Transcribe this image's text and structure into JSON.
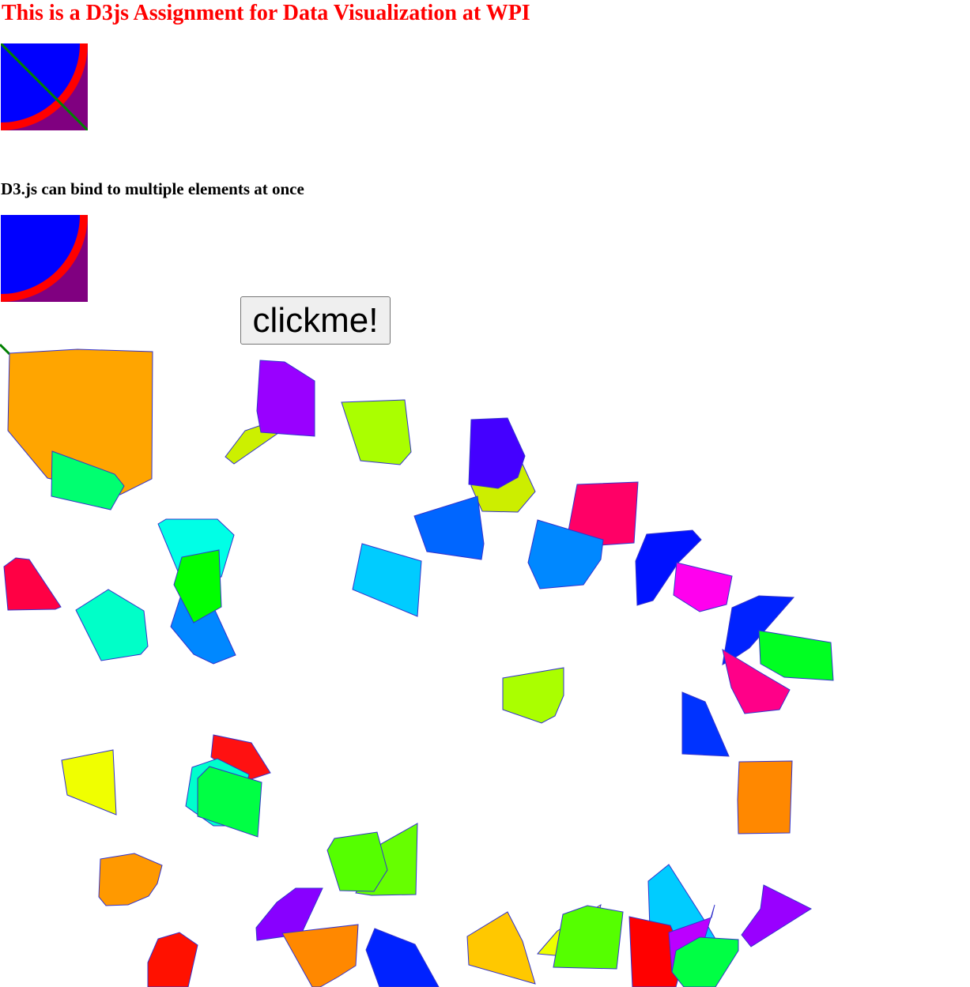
{
  "page": {
    "title": "This is a D3js Assignment for Data Visualization at WPI",
    "subtitle": "D3.js can bind to multiple elements at once",
    "button_label": "clickme!"
  },
  "colors": {
    "title": "#ff0000",
    "square_fill": "#800080",
    "ring_fill": "#ff0000",
    "circle_fill": "#0000ff",
    "diagonal_line": "#008000",
    "polygon_stroke": "#3333cc"
  },
  "polygon_fills": [
    "#ffa500",
    "#00ff70",
    "#ccf000",
    "#9900ff",
    "#aaff00",
    "#ccee00",
    "#4400ff",
    "#ff0066",
    "#0066ff",
    "#0088ff",
    "#00ccff",
    "#00ffe6",
    "#0088ff",
    "#00ff00",
    "#ff0044",
    "#00ffc8",
    "#0011ff",
    "#ff00ee",
    "#0022ff",
    "#00ff22",
    "#ff0088",
    "#aaff00",
    "#0033ff",
    "#f0ff00",
    "#ff1111",
    "#00ffcc",
    "#00ff44",
    "#ff8800",
    "#66ff00",
    "#55ff00",
    "#ff9900",
    "#8800ff",
    "#ff1100",
    "#ff8800",
    "#0022ff",
    "#ffc800",
    "#eeff00",
    "#55ff00",
    "#00ccff",
    "#ff0000",
    "#bb00ff",
    "#00ff44",
    "#9900ff"
  ]
}
